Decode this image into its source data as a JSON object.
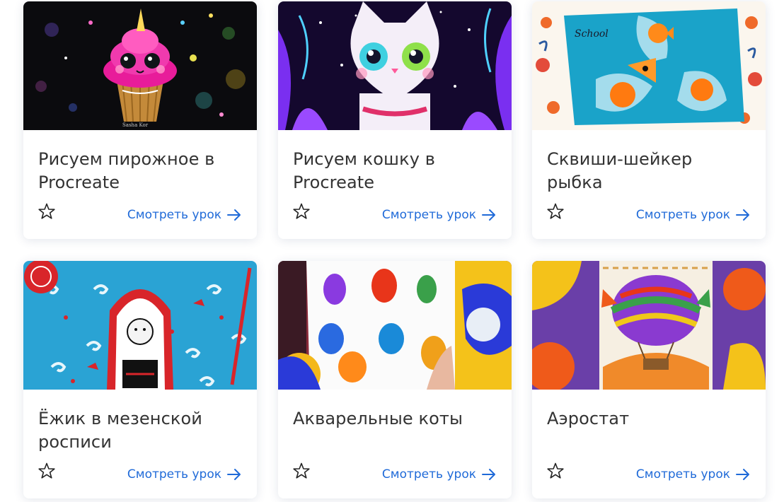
{
  "lessons": [
    {
      "title": "Рисуем пирожное в Procreate",
      "link_label": "Смотреть урок",
      "favorite_icon": "star-outline-icon",
      "thumb_theme": "cupcake",
      "thumb_bg": "#0b0b0e",
      "thumb_signature": "Sasha Kor"
    },
    {
      "title": "Рисуем кошку в Procreate",
      "link_label": "Смотреть урок",
      "favorite_icon": "star-outline-icon",
      "thumb_theme": "cat",
      "thumb_bg": "#1a0f3a"
    },
    {
      "title": "Сквиши-шейкер рыбка",
      "link_label": "Смотреть урок",
      "favorite_icon": "star-outline-icon",
      "thumb_theme": "squishy-fish",
      "thumb_bg": "#1aa3c9",
      "thumb_sign_text": "School"
    },
    {
      "title": "Ёжик в мезенской росписи",
      "link_label": "Смотреть урок",
      "favorite_icon": "star-outline-icon",
      "thumb_theme": "mezen-hedgehog",
      "thumb_bg": "#29a6d6"
    },
    {
      "title": "Акварельные коты",
      "link_label": "Смотреть урок",
      "favorite_icon": "star-outline-icon",
      "thumb_theme": "watercolor-cats",
      "thumb_bg": "#ffffff"
    },
    {
      "title": "Аэростат",
      "link_label": "Смотреть урок",
      "favorite_icon": "star-outline-icon",
      "thumb_theme": "balloon",
      "thumb_bg": "#6a3fa8"
    }
  ],
  "colors": {
    "title_text": "#333333",
    "link": "#1f6ad8",
    "card_bg": "#ffffff"
  }
}
